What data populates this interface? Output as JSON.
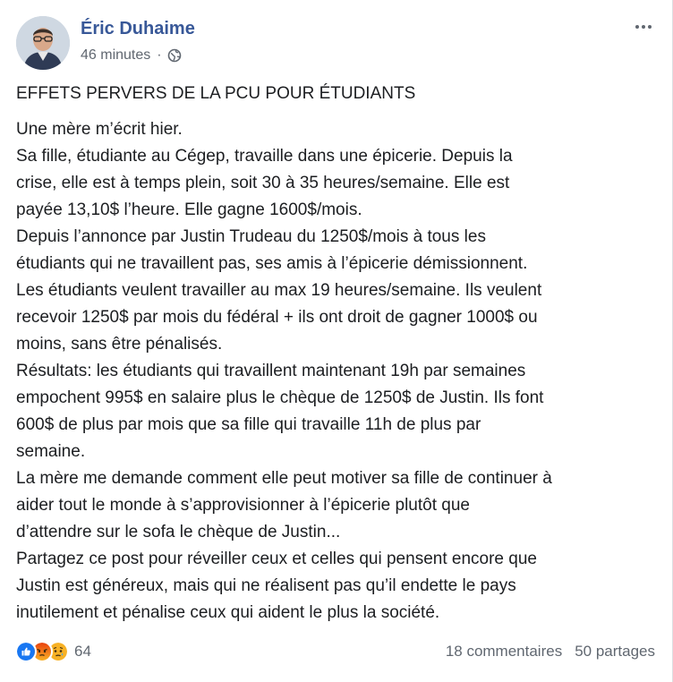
{
  "post": {
    "author": "Éric Duhaime",
    "timestamp": "46 minutes",
    "separator": "·",
    "privacy_icon": "globe-icon",
    "more_icon": "more-options-icon",
    "headline": "EFFETS PERVERS DE LA PCU POUR ÉTUDIANTS",
    "lines": [
      "Une mère m’écrit hier.",
      "Sa fille, étudiante au Cégep, travaille dans une épicerie. Depuis la",
      "crise, elle est à temps plein, soit 30 à 35 heures/semaine. Elle est",
      "payée 13,10$ l’heure. Elle gagne 1600$/mois.",
      "Depuis l’annonce par Justin Trudeau du 1250$/mois à tous les",
      "étudiants qui ne travaillent pas, ses amis à l’épicerie démissionnent.",
      "Les étudiants veulent travailler au max 19 heures/semaine. Ils veulent",
      "recevoir 1250$ par mois du fédéral + ils ont droit de gagner 1000$ ou",
      "moins, sans être pénalisés.",
      "Résultats: les étudiants qui travaillent maintenant 19h par semaines",
      "empochent 995$ en salaire plus le chèque de 1250$ de Justin. Ils font",
      "600$ de plus par mois que sa fille qui travaille 11h de plus par",
      "semaine.",
      "La mère me demande comment elle peut motiver sa fille de continuer à",
      "aider tout le monde à s’approvisionner à l’épicerie plutôt que",
      "d’attendre sur le sofa le chèque de Justin...",
      "Partagez ce post pour réveiller ceux et celles qui pensent encore que",
      "Justin est généreux, mais qui ne réalisent pas qu’il endette le pays",
      "inutilement et pénalise ceux qui aident le plus la société."
    ]
  },
  "footer": {
    "reactions": [
      "like-reaction-icon",
      "angry-reaction-icon",
      "sad-reaction-icon"
    ],
    "reaction_count": "64",
    "comments": "18 commentaires",
    "shares": "50 partages"
  },
  "colors": {
    "author": "#385898",
    "like": "#1877f2",
    "angry": "#e9710f",
    "sad": "#f7b125",
    "meta": "#606770"
  }
}
